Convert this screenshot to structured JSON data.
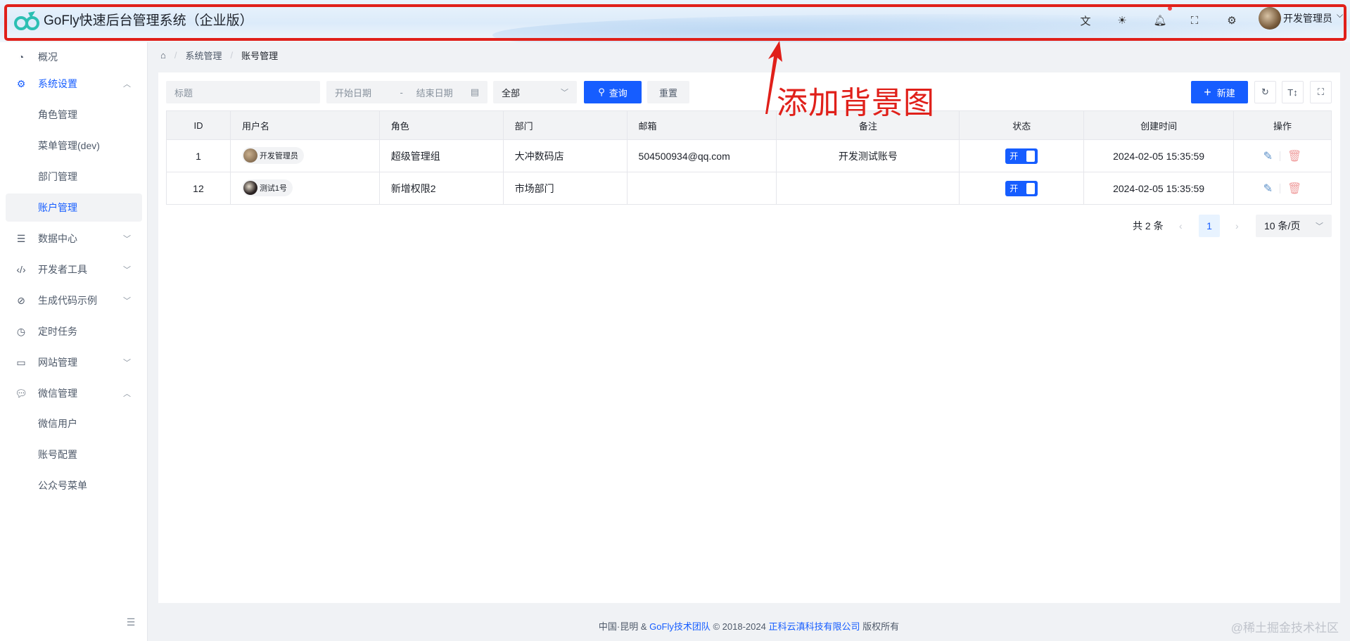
{
  "header": {
    "title": "GoFly快速后台管理系统（企业版）",
    "user": "开发管理员",
    "icons": [
      "translate-icon",
      "theme-icon",
      "bell-icon",
      "fullscreen-icon",
      "settings-icon"
    ]
  },
  "sidebar": {
    "items": [
      {
        "label": "概况",
        "icon": "dashboard-icon"
      },
      {
        "label": "系统设置",
        "icon": "gear-icon"
      },
      {
        "label": "角色管理"
      },
      {
        "label": "菜单管理(dev)"
      },
      {
        "label": "部门管理"
      },
      {
        "label": "账户管理"
      },
      {
        "label": "数据中心",
        "icon": "database-icon"
      },
      {
        "label": "开发者工具",
        "icon": "code-icon"
      },
      {
        "label": "生成代码示例",
        "icon": "compass-icon"
      },
      {
        "label": "定时任务",
        "icon": "clock-icon"
      },
      {
        "label": "网站管理",
        "icon": "monitor-icon"
      },
      {
        "label": "微信管理",
        "icon": "wechat-icon"
      },
      {
        "label": "微信用户"
      },
      {
        "label": "账号配置"
      },
      {
        "label": "公众号菜单"
      }
    ]
  },
  "breadcrumb": [
    "系统管理",
    "账号管理"
  ],
  "filters": {
    "title_placeholder": "标题",
    "start_date": "开始日期",
    "date_sep": "-",
    "end_date": "结束日期",
    "status": "全部",
    "search": "查询",
    "reset": "重置",
    "new": "新建"
  },
  "table": {
    "columns": [
      "ID",
      "用户名",
      "角色",
      "部门",
      "邮箱",
      "备注",
      "状态",
      "创建时间",
      "操作"
    ],
    "rows": [
      {
        "id": "1",
        "username": "开发管理员",
        "role": "超级管理组",
        "dept": "大冲数码店",
        "email": "504500934@qq.com",
        "remark": "开发测试账号",
        "status": "开",
        "created": "2024-02-05 15:35:59"
      },
      {
        "id": "12",
        "username": "测试1号",
        "role": "新增权限2",
        "dept": "市场部门",
        "email": "",
        "remark": "",
        "status": "开",
        "created": "2024-02-05 15:35:59"
      }
    ]
  },
  "pagination": {
    "total": "共 2 条",
    "page": "1",
    "page_size": "10 条/页"
  },
  "footer": {
    "prefix": "中国·昆明 &",
    "team": "GoFly技术团队",
    "copy": "© 2018-2024",
    "company": "正科云滇科技有限公司",
    "suffix": "版权所有"
  },
  "watermark": "@稀土掘金技术社区",
  "annotation": "添加背景图",
  "colors": {
    "primary": "#165dff",
    "annotation": "#e0201a"
  }
}
